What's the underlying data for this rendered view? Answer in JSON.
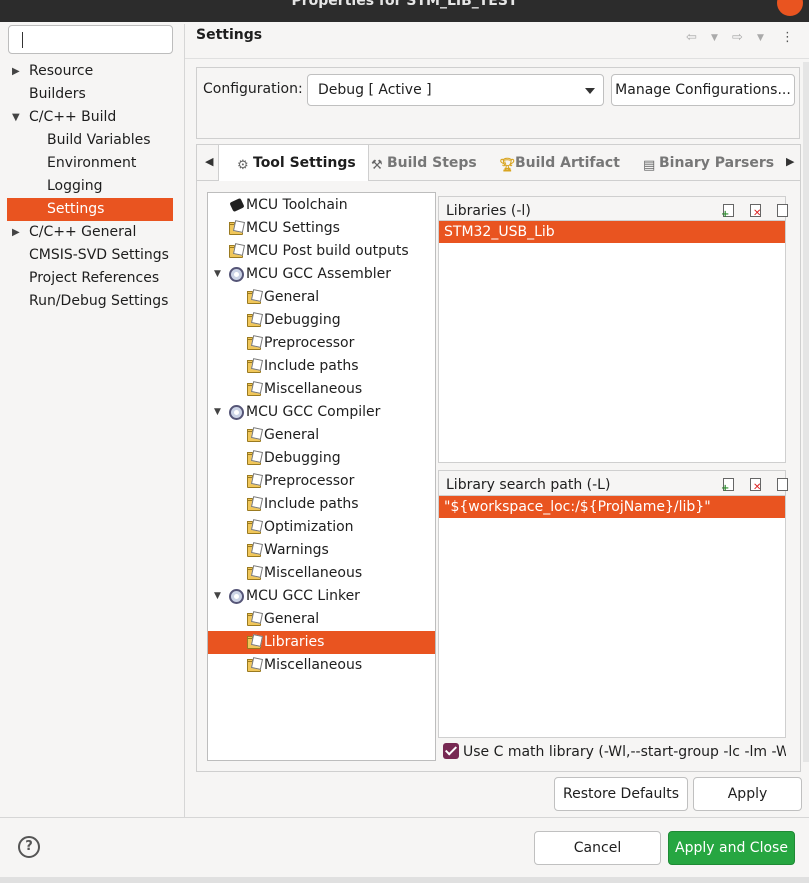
{
  "window": {
    "title": "Properties for STM_LIB_TEST"
  },
  "filter": {
    "value": ""
  },
  "nav": {
    "items": [
      {
        "label": "Resource",
        "expander": "▶"
      },
      {
        "label": "Builders",
        "expander": ""
      },
      {
        "label": "C/C++ Build",
        "expander": "▼"
      },
      {
        "label": "Build Variables",
        "expander": ""
      },
      {
        "label": "Environment",
        "expander": ""
      },
      {
        "label": "Logging",
        "expander": ""
      },
      {
        "label": "Settings",
        "expander": "",
        "selected": true
      },
      {
        "label": "C/C++ General",
        "expander": "▶"
      },
      {
        "label": "CMSIS-SVD Settings",
        "expander": ""
      },
      {
        "label": "Project References",
        "expander": ""
      },
      {
        "label": "Run/Debug Settings",
        "expander": ""
      }
    ]
  },
  "header": {
    "title": "Settings",
    "icons": [
      "back-arrow-icon",
      "dropdown-icon",
      "forward-arrow-icon",
      "dropdown-icon",
      "more-vertical-icon"
    ]
  },
  "configuration": {
    "label": "Configuration:",
    "value": "Debug  [ Active ]",
    "manage_label": "Manage Configurations..."
  },
  "tabs": [
    {
      "label": "Tool Settings",
      "icon": "tool-settings-icon",
      "active": true
    },
    {
      "label": "Build Steps",
      "icon": "build-steps-icon"
    },
    {
      "label": "Build Artifact",
      "icon": "build-artifact-icon"
    },
    {
      "label": "Binary Parsers",
      "icon": "binary-parsers-icon"
    }
  ],
  "tree": [
    {
      "label": "MCU Toolchain",
      "icon": "chip-icon"
    },
    {
      "label": "MCU Settings",
      "icon": "folder-icon"
    },
    {
      "label": "MCU Post build outputs",
      "icon": "folder-icon"
    },
    {
      "label": "MCU GCC Assembler",
      "icon": "gear-icon",
      "expander": "▼"
    },
    {
      "label": "General",
      "icon": "folder-icon"
    },
    {
      "label": "Debugging",
      "icon": "folder-icon"
    },
    {
      "label": "Preprocessor",
      "icon": "folder-icon"
    },
    {
      "label": "Include paths",
      "icon": "folder-icon"
    },
    {
      "label": "Miscellaneous",
      "icon": "folder-icon"
    },
    {
      "label": "MCU GCC Compiler",
      "icon": "gear-icon",
      "expander": "▼"
    },
    {
      "label": "General",
      "icon": "folder-icon"
    },
    {
      "label": "Debugging",
      "icon": "folder-icon"
    },
    {
      "label": "Preprocessor",
      "icon": "folder-icon"
    },
    {
      "label": "Include paths",
      "icon": "folder-icon"
    },
    {
      "label": "Optimization",
      "icon": "folder-icon"
    },
    {
      "label": "Warnings",
      "icon": "folder-icon"
    },
    {
      "label": "Miscellaneous",
      "icon": "folder-icon"
    },
    {
      "label": "MCU GCC Linker",
      "icon": "gear-icon",
      "expander": "▼"
    },
    {
      "label": "General",
      "icon": "folder-icon"
    },
    {
      "label": "Libraries",
      "icon": "folder-icon",
      "selected": true
    },
    {
      "label": "Miscellaneous",
      "icon": "folder-icon"
    }
  ],
  "libraries": {
    "header": "Libraries (-l)",
    "items": [
      "STM32_USB_Lib"
    ]
  },
  "library_paths": {
    "header": "Library search path (-L)",
    "items": [
      "\"${workspace_loc:/${ProjName}/lib}\""
    ]
  },
  "math_option": {
    "label": "Use C math library (-Wl,--start-group -lc -lm -Wl,--end-group)",
    "checked": true
  },
  "buttons": {
    "restore_defaults": "Restore Defaults",
    "apply": "Apply",
    "cancel": "Cancel",
    "apply_and_close": "Apply and Close"
  },
  "colors": {
    "selection": "#e95420",
    "primary_button": "#26a641",
    "checkbox": "#772953"
  }
}
